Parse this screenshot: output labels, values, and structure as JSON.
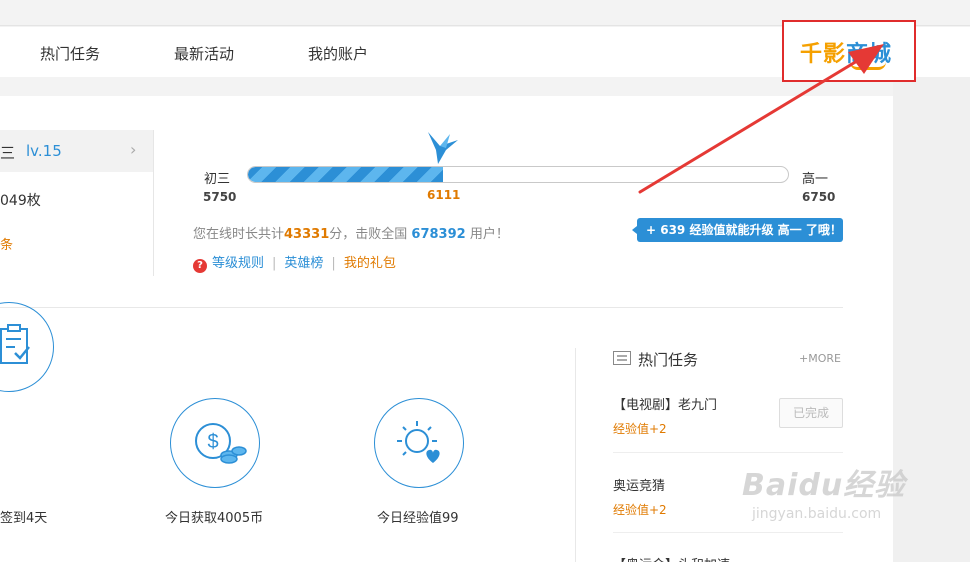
{
  "nav": {
    "items": [
      "热门任务",
      "最新活动",
      "我的账户"
    ],
    "logo_text_a": "千影",
    "logo_text_b": "商城"
  },
  "user": {
    "name_partial": "三",
    "level": "lv.15",
    "coins_partial": "049枚",
    "extra_partial": "条"
  },
  "level_bar": {
    "start_name": "初三",
    "start_value": "5750",
    "end_name": "高一",
    "end_value": "6750",
    "current_value": "6111",
    "progress": 0.361
  },
  "stats_line": {
    "prefix": "您在线时长共计",
    "minutes": "43331",
    "middle": "分，击败全国",
    "users": "678392",
    "suffix": "用户！"
  },
  "upgrade_tip": "+ 639 经验值就能升级 高一 了哦！",
  "links": {
    "help_icon": "?",
    "rules": "等级规则",
    "heroes": "英雄榜",
    "gifts": "我的礼包",
    "separator": "|"
  },
  "daily": [
    {
      "label": "签到4天",
      "icon": "clipboard-check-icon"
    },
    {
      "label": "今日获取4005币",
      "icon": "dollar-coins-icon"
    },
    {
      "label": "今日经验值99",
      "icon": "sun-heart-icon"
    }
  ],
  "hot_tasks": {
    "title": "热门任务",
    "more": "+MORE",
    "items": [
      {
        "name": "【电视剧】老九门",
        "reward": "经验值+2",
        "button": "已完成"
      },
      {
        "name": "奥运竞猜",
        "reward": "经验值+2"
      },
      {
        "name": "【奥运会】头和加速"
      }
    ]
  },
  "watermark": {
    "main": "Baidu经验",
    "sub": "jingyan.baidu.com"
  },
  "colors": {
    "accent_blue": "#2c8fd6",
    "accent_orange": "#e07a00",
    "highlight_red": "#e02c2c"
  }
}
